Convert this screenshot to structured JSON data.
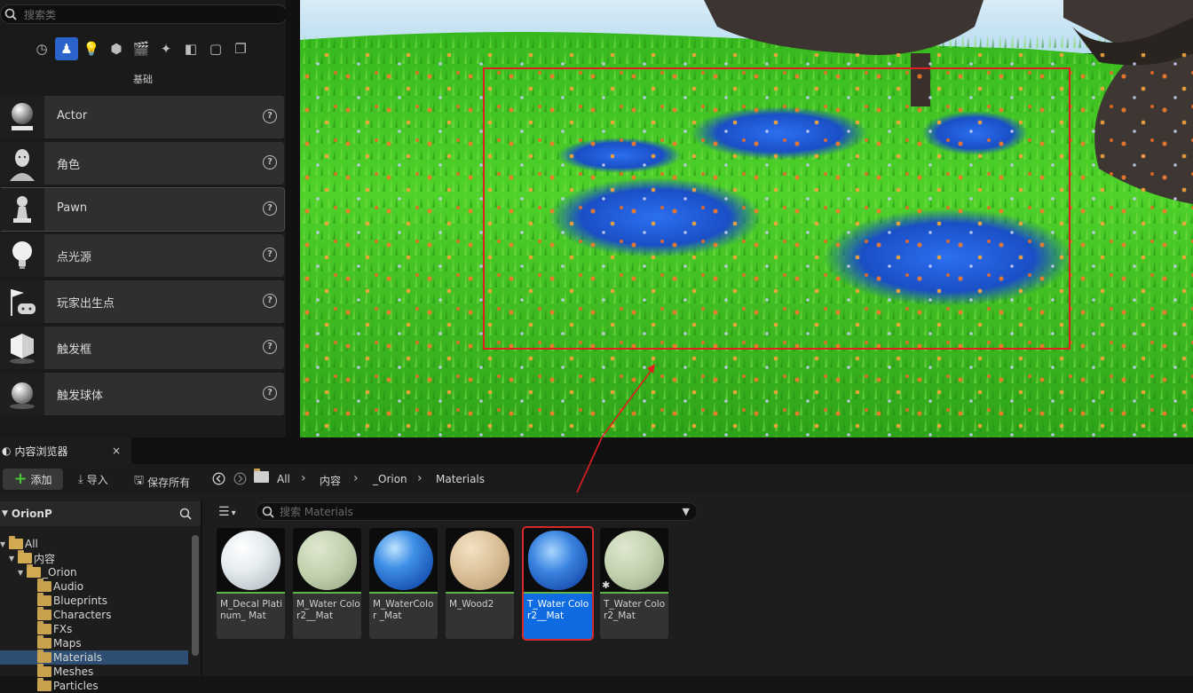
{
  "place_actors": {
    "search_placeholder": "搜索类",
    "category_icons": [
      "recent-icon",
      "basic-icon",
      "lights-icon",
      "shapes-icon",
      "cinematic-icon",
      "visual-effects-icon",
      "geometry-icon",
      "volumes-icon",
      "all-classes-icon"
    ],
    "active_category": "basic-icon",
    "category_label": "基础",
    "items": [
      {
        "label": "Actor",
        "icon": "actor-sphere-icon"
      },
      {
        "label": "角色",
        "icon": "character-icon"
      },
      {
        "label": "Pawn",
        "icon": "pawn-icon"
      },
      {
        "label": "点光源",
        "icon": "point-light-icon"
      },
      {
        "label": "玩家出生点",
        "icon": "player-start-icon"
      },
      {
        "label": "触发框",
        "icon": "trigger-box-icon"
      },
      {
        "label": "触发球体",
        "icon": "trigger-sphere-icon"
      }
    ],
    "help_glyph": "?"
  },
  "content_browser": {
    "tab_title": "内容浏览器",
    "tab_close": "×",
    "toolbar": {
      "add_label": "添加",
      "import_label": "导入",
      "save_all_label": "保存所有"
    },
    "breadcrumb": [
      "All",
      "内容",
      "_Orion",
      "Materials"
    ],
    "tree": {
      "project": "OrionP",
      "items": [
        {
          "label": "All",
          "depth": 0,
          "expanded": true
        },
        {
          "label": "内容",
          "depth": 1,
          "expanded": true
        },
        {
          "label": "_Orion",
          "depth": 2,
          "expanded": true
        },
        {
          "label": "Audio",
          "depth": 3
        },
        {
          "label": "Blueprints",
          "depth": 3
        },
        {
          "label": "Characters",
          "depth": 3
        },
        {
          "label": "FXs",
          "depth": 3
        },
        {
          "label": "Maps",
          "depth": 3
        },
        {
          "label": "Materials",
          "depth": 3,
          "selected": true
        },
        {
          "label": "Meshes",
          "depth": 3
        },
        {
          "label": "Particles",
          "depth": 3
        }
      ]
    },
    "search_placeholder": "搜索 Materials",
    "assets": [
      {
        "name": "M_Decal Platinum_ Mat",
        "kind": "material",
        "preview": "white-marble"
      },
      {
        "name": "M_Water Color2__Mat",
        "kind": "material",
        "preview": "pale-green"
      },
      {
        "name": "M_WaterColor _Mat",
        "kind": "material",
        "preview": "blue-water"
      },
      {
        "name": "M_Wood2",
        "kind": "material",
        "preview": "wood"
      },
      {
        "name": "T_Water Color2__Mat",
        "kind": "material",
        "preview": "blue-water-blob",
        "selected": true
      },
      {
        "name": "T_Water Color2_Mat",
        "kind": "material",
        "preview": "pale-green"
      }
    ]
  },
  "colors": {
    "selection_blue": "#0f6be2",
    "highlight_red": "#e02020",
    "add_green": "#4cc33b",
    "material_bar": "#5fb548"
  }
}
